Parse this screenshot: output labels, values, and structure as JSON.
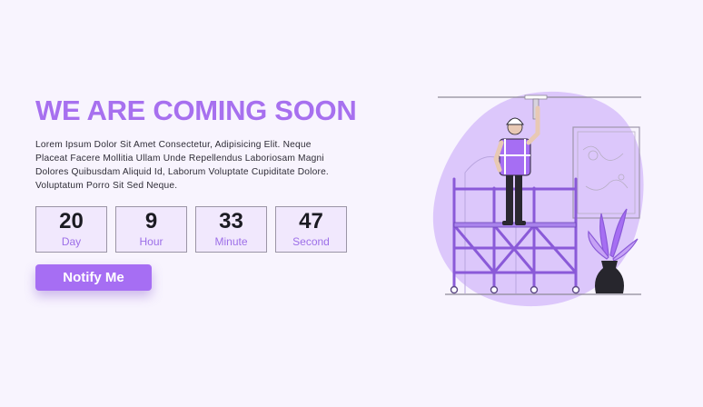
{
  "hero": {
    "title": "WE ARE COMING SOON",
    "description": "Lorem Ipsum Dolor Sit Amet Consectetur, Adipisicing Elit. Neque Placeat Facere Mollitia Ullam Unde Repellendus Laboriosam Magni Dolores Quibusdam Aliquid Id, Laborum Voluptate Cupiditate Dolore. Voluptatum Porro Sit Sed Neque."
  },
  "countdown": [
    {
      "value": "20",
      "label": "Day"
    },
    {
      "value": "9",
      "label": "Hour"
    },
    {
      "value": "33",
      "label": "Minute"
    },
    {
      "value": "47",
      "label": "Second"
    }
  ],
  "notify_button": {
    "label": "Notify Me"
  },
  "colors": {
    "accent": "#a770ef",
    "background": "#f8f4fe",
    "blob": "#dcc7fb",
    "scaffold": "#8a5ad8"
  },
  "illustration": {
    "icon": "worker-on-scaffold-illustration"
  }
}
